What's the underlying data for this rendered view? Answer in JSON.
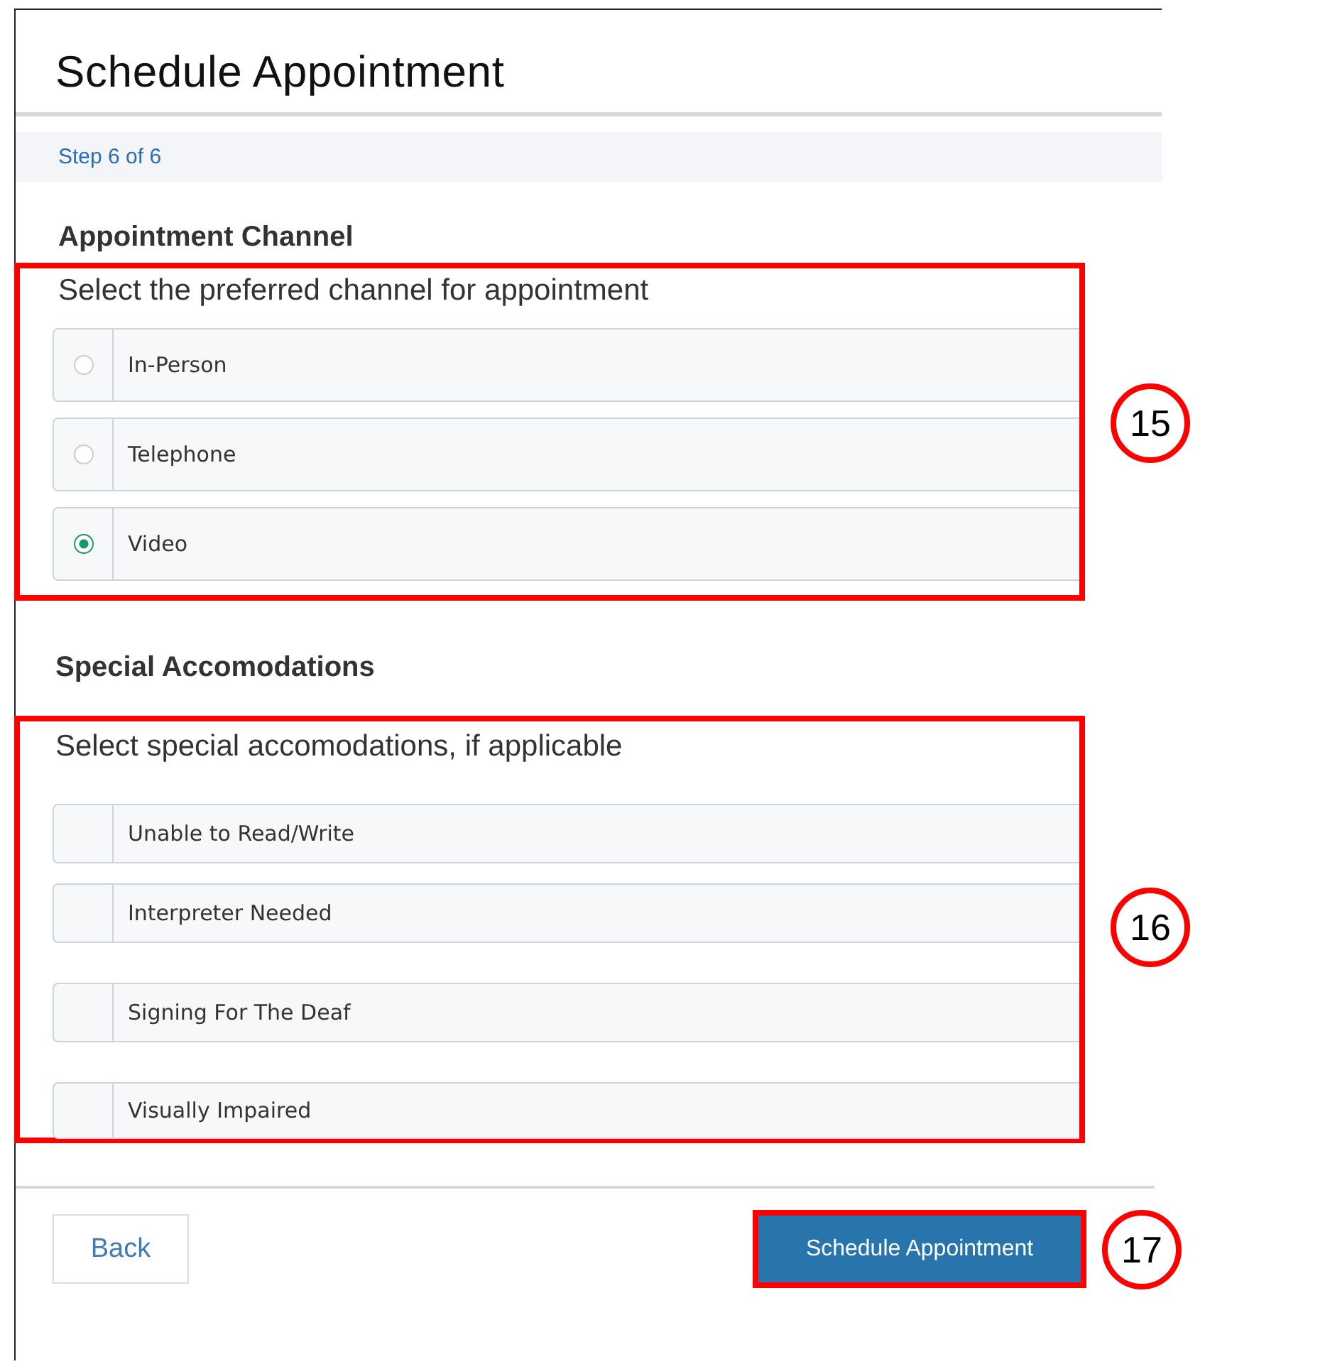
{
  "title": "Schedule Appointment",
  "step": "Step 6 of 6",
  "channel_section": {
    "heading": "Appointment Channel",
    "prompt": "Select the preferred channel for appointment",
    "callout": "15",
    "options": [
      {
        "label": "In-Person",
        "selected": false
      },
      {
        "label": "Telephone",
        "selected": false
      },
      {
        "label": "Video",
        "selected": true
      }
    ]
  },
  "accommodations_section": {
    "heading": "Special Accomodations",
    "prompt": "Select special accomodations, if applicable",
    "callout": "16",
    "options": [
      {
        "label": "Unable to Read/Write",
        "checked": false
      },
      {
        "label": "Interpreter Needed",
        "checked": false
      },
      {
        "label": "Signing For The Deaf",
        "checked": false
      },
      {
        "label": "Visually Impaired",
        "checked": false
      }
    ]
  },
  "buttons": {
    "back": "Back",
    "submit": "Schedule Appointment",
    "submit_callout": "17"
  }
}
